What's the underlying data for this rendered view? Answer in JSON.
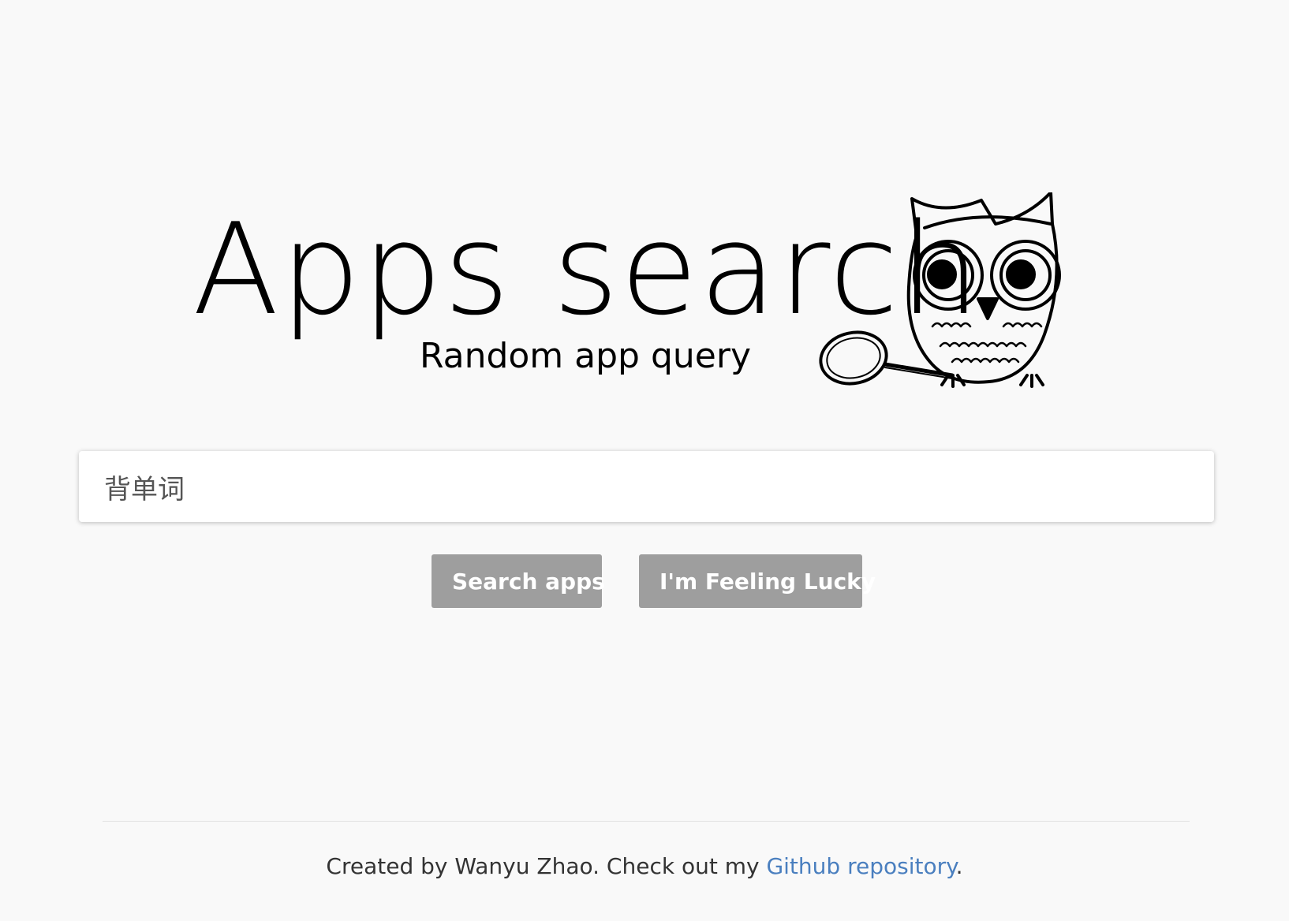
{
  "logo": {
    "title": "Apps search",
    "subtitle": "Random app query",
    "mascot_icon": "owl-with-magnifier-icon"
  },
  "search": {
    "value": "背单词",
    "placeholder": ""
  },
  "buttons": {
    "search_label": "Search apps",
    "lucky_label": "I'm Feeling Lucky"
  },
  "footer": {
    "text_before": "Created by Wanyu Zhao. Check out my ",
    "link_label": "Github repository",
    "text_after": "."
  },
  "colors": {
    "background": "#f9f9f9",
    "button": "#9e9e9e",
    "link": "#4a7fbf"
  }
}
